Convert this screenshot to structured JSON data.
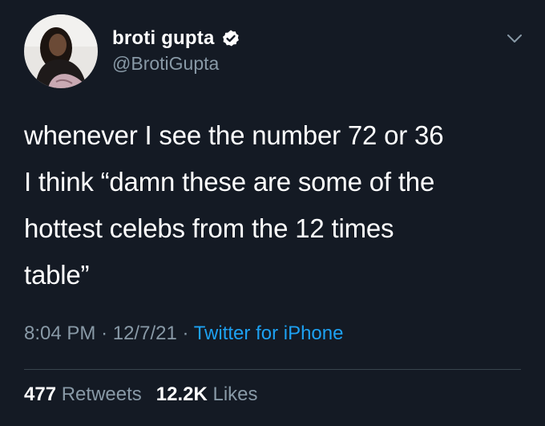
{
  "tweet": {
    "author": {
      "display_name": "broti gupta",
      "handle": "@BrotiGupta",
      "verified": true
    },
    "text_lines": [
      "whenever I see the number 72 or 36",
      "I think “damn these are some of the",
      "hottest celebs from the 12 times",
      "table”"
    ],
    "time": "8:04 PM",
    "separator": "·",
    "date": "12/7/21",
    "source": "Twitter for iPhone",
    "stats": {
      "retweets_count": "477",
      "retweets_label": "Retweets",
      "likes_count": "12.2K",
      "likes_label": "Likes"
    },
    "icons": {
      "verified": "verified-badge-icon",
      "menu": "chevron-down-icon"
    },
    "colors": {
      "background": "#141a24",
      "text": "#ffffff",
      "secondary": "#8899a6",
      "link": "#1da1f2",
      "divider": "#38444d"
    }
  }
}
